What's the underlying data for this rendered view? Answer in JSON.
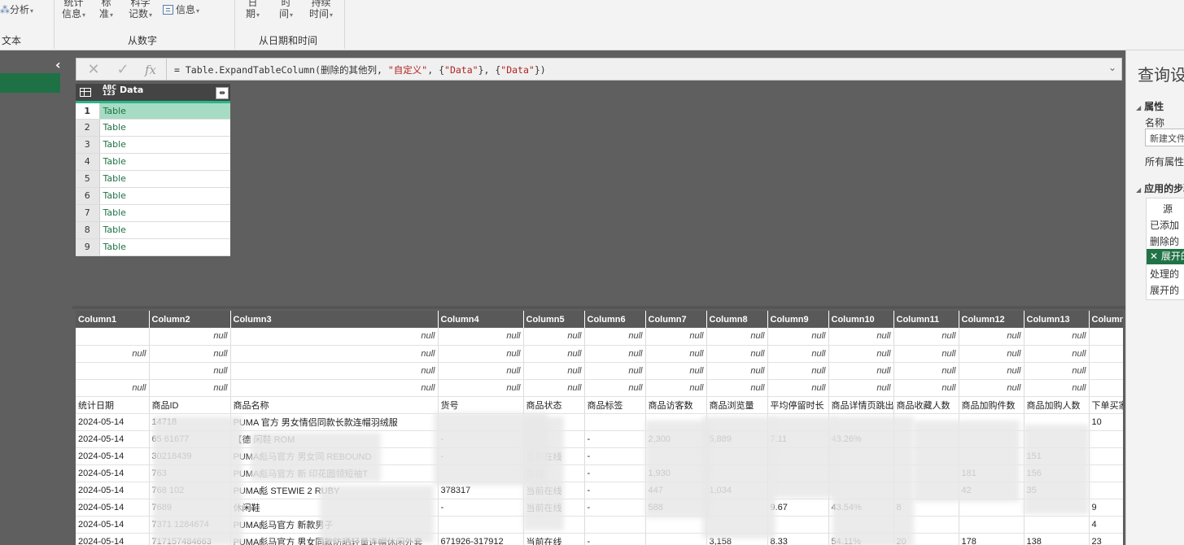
{
  "ribbon": {
    "analysis_label": "分析",
    "stats_label_1": "统计",
    "stats_label_2": "信息",
    "standard_label_1": "标",
    "standard_label_2": "准",
    "scientific_label_1": "科学",
    "scientific_label_2": "记数",
    "info_label": "信息",
    "date_label_1": "日",
    "date_label_2": "期",
    "time_label_1": "时",
    "time_label_2": "间",
    "duration_label_1": "持续",
    "duration_label_2": "时间",
    "group_text": "文本",
    "group_from_number": "从数字",
    "group_from_datetime": "从日期和时间"
  },
  "formula": {
    "prefix": "= Table.ExpandTableColumn(删除的其他列, ",
    "arg1": "\"自定义\"",
    "mid1": ", {",
    "arg2": "\"Data\"",
    "mid2": "}, {",
    "arg3": "\"Data\"",
    "suffix": "})",
    "fx": "fx"
  },
  "top_table": {
    "type_line1": "ABC",
    "type_line2": "123",
    "header": "Data",
    "rows": [
      {
        "n": "1",
        "v": "Table"
      },
      {
        "n": "2",
        "v": "Table"
      },
      {
        "n": "3",
        "v": "Table"
      },
      {
        "n": "4",
        "v": "Table"
      },
      {
        "n": "5",
        "v": "Table"
      },
      {
        "n": "6",
        "v": "Table"
      },
      {
        "n": "7",
        "v": "Table"
      },
      {
        "n": "8",
        "v": "Table"
      },
      {
        "n": "9",
        "v": "Table"
      }
    ]
  },
  "preview": {
    "columns": [
      "Column1",
      "Column2",
      "Column3",
      "Column4",
      "Column5",
      "Column6",
      "Column7",
      "Column8",
      "Column9",
      "Column10",
      "Column11",
      "Column12",
      "Column13",
      "Column"
    ],
    "rows": [
      [
        "",
        "null",
        "null",
        "null",
        "null",
        "null",
        "null",
        "null",
        "null",
        "null",
        "null",
        "null",
        "null",
        ""
      ],
      [
        "null",
        "null",
        "null",
        "null",
        "null",
        "null",
        "null",
        "null",
        "null",
        "null",
        "null",
        "null",
        "null",
        ""
      ],
      [
        "",
        "null",
        "null",
        "null",
        "null",
        "null",
        "null",
        "null",
        "null",
        "null",
        "null",
        "null",
        "null",
        ""
      ],
      [
        "null",
        "null",
        "null",
        "null",
        "null",
        "null",
        "null",
        "null",
        "null",
        "null",
        "null",
        "null",
        "null",
        ""
      ],
      [
        "统计日期",
        "商品ID",
        "商品名称",
        "货号",
        "商品状态",
        "商品标签",
        "商品访客数",
        "商品浏览量",
        "平均停留时长",
        "商品详情页跳出",
        "商品收藏人数",
        "商品加购件数",
        "商品加购人数",
        "下单买家"
      ],
      [
        "2024-05-14",
        "14718",
        "PUMA 官方 男女情侣同款长款连帽羽绒服",
        "",
        "",
        "",
        "",
        "",
        "",
        "",
        "",
        "",
        "",
        "10"
      ],
      [
        "2024-05-14",
        "65 61677",
        "【德 闲鞋 ROM",
        "-",
        "",
        "-",
        "2,300",
        "5,889",
        "7.11",
        "43.26%",
        "",
        "",
        "",
        ""
      ],
      [
        "2024-05-14",
        "30218439",
        "PUMA彪马官方 男女同 REBOUND",
        "-",
        "当前在线",
        "-",
        "",
        "",
        "",
        "",
        "",
        "",
        "151",
        ""
      ],
      [
        "2024-05-14",
        "763",
        "PUMA彪马官方 新 印花圆领短袖T",
        "",
        "在线",
        "-",
        "1,930",
        "",
        "",
        "",
        "",
        "181",
        "156",
        ""
      ],
      [
        "2024-05-14",
        "768 102",
        "PUMA彪 STEWIE 2 RUBY",
        "378317",
        "当前在线",
        "-",
        "447",
        "1,034",
        "",
        "",
        "",
        "42",
        "35",
        ""
      ],
      [
        "2024-05-14",
        "7689",
        "休闲鞋",
        "-",
        "当前在线",
        "-",
        "588",
        "",
        "9.67",
        "43.54%",
        "8",
        "",
        "",
        "9"
      ],
      [
        "2024-05-14",
        "7371 1284674",
        "PUMA彪马官方 新款男子",
        "",
        "",
        "",
        "",
        "",
        "",
        "",
        "",
        "",
        "",
        "4"
      ],
      [
        "2024-05-14",
        "717157484663",
        "PUMA彪马官方 男女同款防晒轻量连帽休闲外套",
        "671926-317912",
        "当前在线",
        "-",
        "",
        "3,158",
        "8.33",
        "54.11%",
        "20",
        "178",
        "138",
        "23"
      ]
    ]
  },
  "query_settings": {
    "title": "查询设置",
    "properties_header": "属性",
    "name_label": "名称",
    "name_value": "新建文件",
    "all_properties": "所有属性",
    "applied_steps_header": "应用的步骤",
    "steps": [
      "源",
      "已添加",
      "删除的",
      "展开的",
      "处理的",
      "展开的"
    ]
  }
}
